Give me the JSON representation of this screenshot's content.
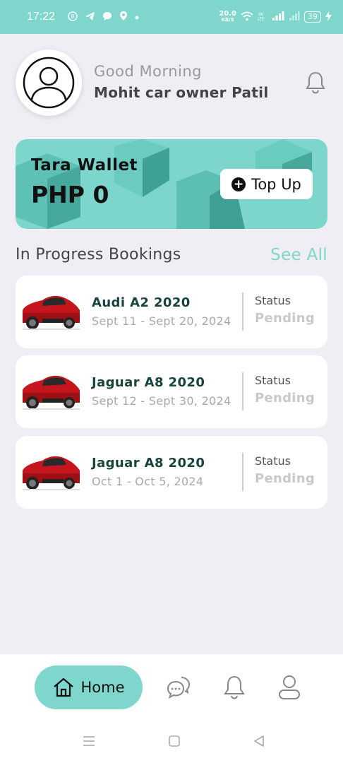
{
  "status_bar": {
    "time": "17:22",
    "net_speed_value": "20.0",
    "net_speed_unit": "KB/S",
    "battery": "39"
  },
  "header": {
    "greeting": "Good Morning",
    "user_name": "Mohit car owner Patil"
  },
  "wallet": {
    "title": "Tara Wallet",
    "balance": "PHP 0",
    "top_up_label": "Top Up"
  },
  "bookings_section": {
    "title": "In Progress Bookings",
    "see_all_label": "See All",
    "items": [
      {
        "car": "Audi A2 2020",
        "dates": "Sept 11 - Sept 20, 2024",
        "status_label": "Status",
        "status": "Pending"
      },
      {
        "car": "Jaguar  A8 2020",
        "dates": "Sept 12 - Sept 30, 2024",
        "status_label": "Status",
        "status": "Pending"
      },
      {
        "car": "Jaguar  A8 2020",
        "dates": "Oct 1 - Oct 5, 2024",
        "status_label": "Status",
        "status": "Pending"
      }
    ]
  },
  "bottom_nav": {
    "home_label": "Home",
    "items": [
      "home-icon",
      "chat-icon",
      "bell-icon",
      "profile-icon"
    ]
  },
  "colors": {
    "accent": "#7fd6cc",
    "wallet_bg": "#7dd6cb",
    "car_name": "#19443e",
    "pending": "#c9c9c9"
  }
}
